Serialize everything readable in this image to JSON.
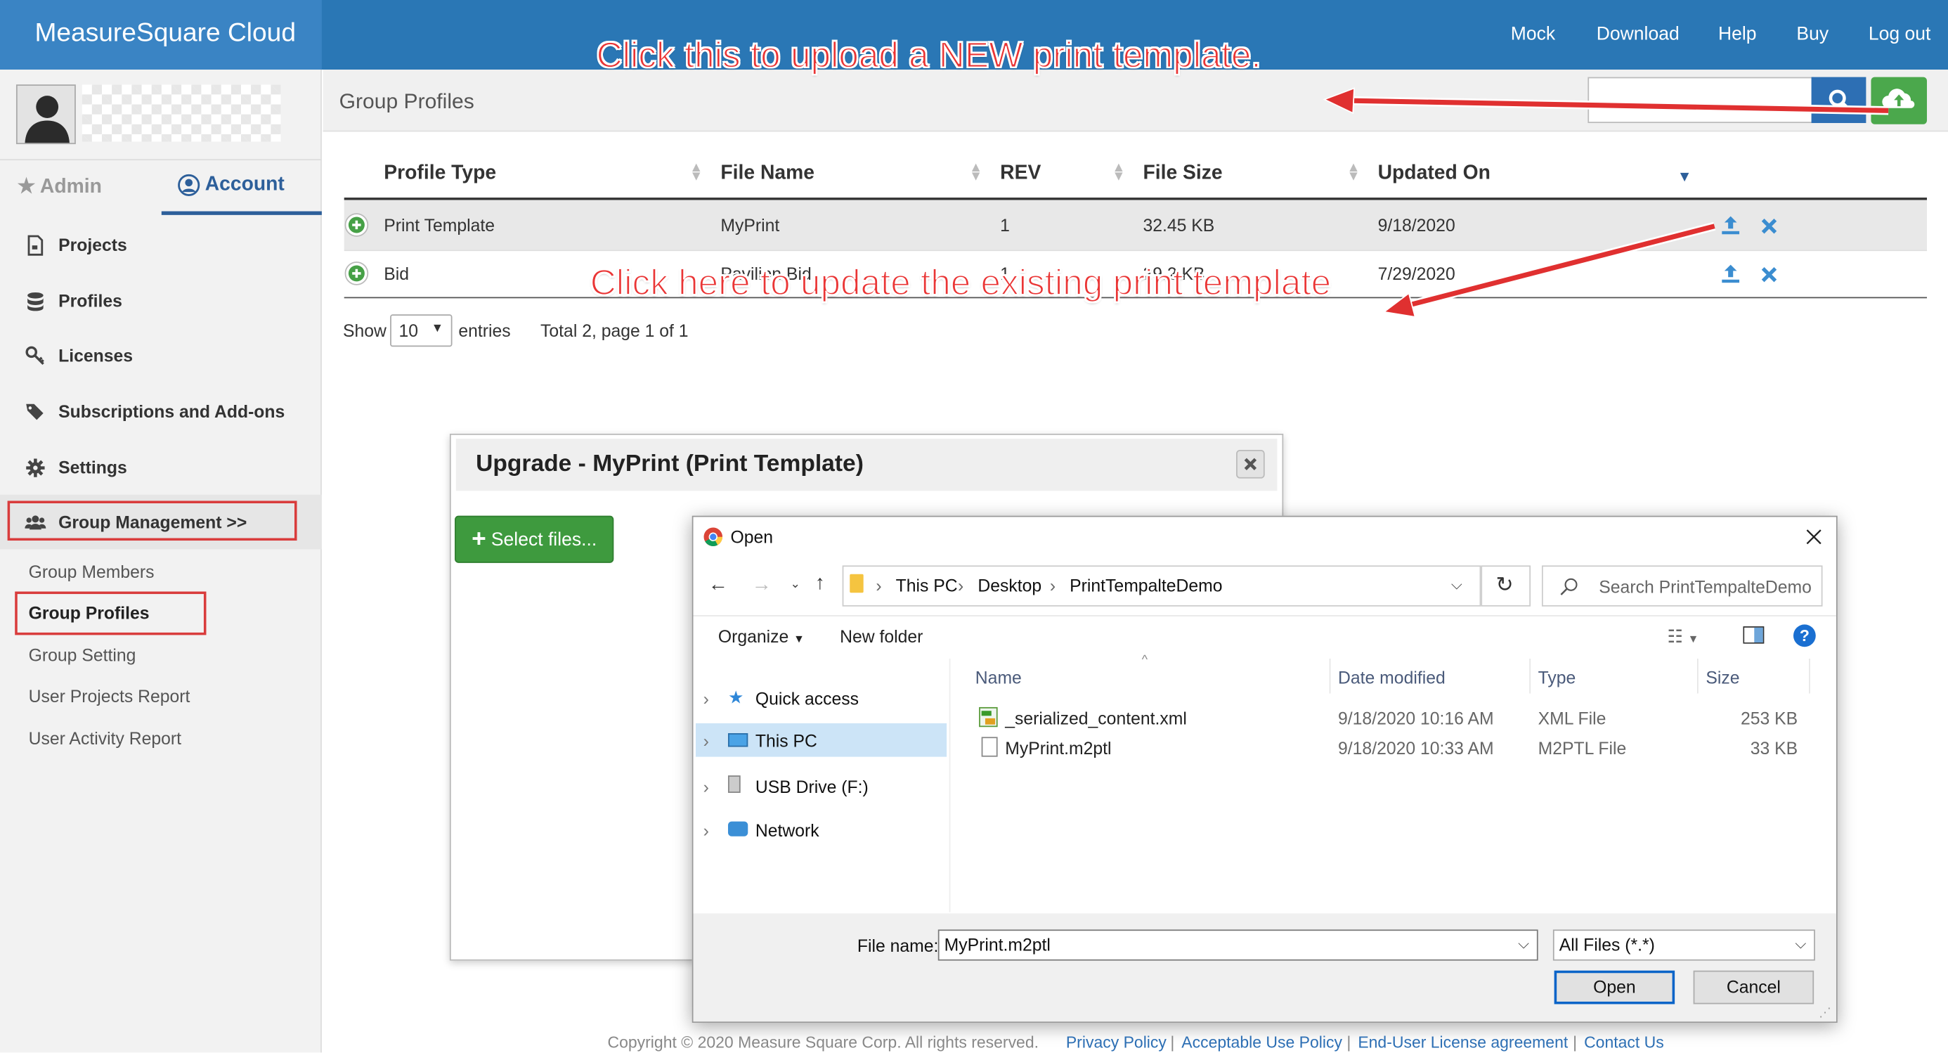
{
  "app": {
    "brand": "MeasureSquare Cloud"
  },
  "topnav": [
    "Mock",
    "Download",
    "Help",
    "Buy",
    "Log out"
  ],
  "sidebar": {
    "tabs": {
      "admin": "Admin",
      "account": "Account"
    },
    "menu": [
      "Projects",
      "Profiles",
      "Licenses",
      "Subscriptions and Add-ons",
      "Settings",
      "Group Management >>"
    ],
    "submenu": [
      "Group Members",
      "Group Profiles",
      "Group Setting",
      "User Projects Report",
      "User Activity Report"
    ]
  },
  "main": {
    "title": "Group Profiles",
    "search_placeholder": "",
    "columns": [
      "Profile Type",
      "File Name",
      "REV",
      "File Size",
      "Updated On"
    ],
    "rows": [
      {
        "type": "Print Template",
        "name": "MyPrint",
        "rev": "1",
        "size": "32.45 KB",
        "updated": "9/18/2020"
      },
      {
        "type": "Bid",
        "name": "Pavilion Bid",
        "rev": "1",
        "size": "29.2 KB",
        "updated": "7/29/2020"
      }
    ],
    "show_label": "Show",
    "page_size": "10",
    "entries_label": "entries",
    "paging": "Total 2, page 1 of 1"
  },
  "upgrade_dialog": {
    "title": "Upgrade - MyPrint (Print Template)",
    "select_files": "Select files..."
  },
  "open_dialog": {
    "title": "Open",
    "path": [
      "This PC",
      "Desktop",
      "PrintTempalteDemo"
    ],
    "search_placeholder": "Search PrintTempalteDemo",
    "organize": "Organize",
    "new_folder": "New folder",
    "tree": [
      "Quick access",
      "This PC",
      "USB Drive (F:)",
      "Network"
    ],
    "columns": [
      "Name",
      "Date modified",
      "Type",
      "Size"
    ],
    "files": [
      {
        "name": "_serialized_content.xml",
        "date": "9/18/2020 10:16 AM",
        "type": "XML File",
        "size": "253 KB"
      },
      {
        "name": "MyPrint.m2ptl",
        "date": "9/18/2020 10:33 AM",
        "type": "M2PTL File",
        "size": "33 KB"
      }
    ],
    "file_name_label": "File name:",
    "file_name_value": "MyPrint.m2ptl",
    "file_filter": "All Files (*.*)",
    "open_button": "Open",
    "cancel_button": "Cancel"
  },
  "footer": {
    "copyright": "Copyright © 2020 Measure Square Corp. All rights reserved.",
    "links": [
      "Privacy Policy",
      "Acceptable Use Policy",
      "End-User License agreement",
      "Contact Us"
    ],
    "separator": "|"
  },
  "annotations": {
    "new_template": "Click this to upload a NEW print template.",
    "update_template": "Click here to update the existing print template"
  },
  "colors": {
    "topbar": "#2a77b5",
    "accent": "#2d5f9a",
    "upload_green": "#4ba84c",
    "annotation_red": "#ea3535"
  }
}
